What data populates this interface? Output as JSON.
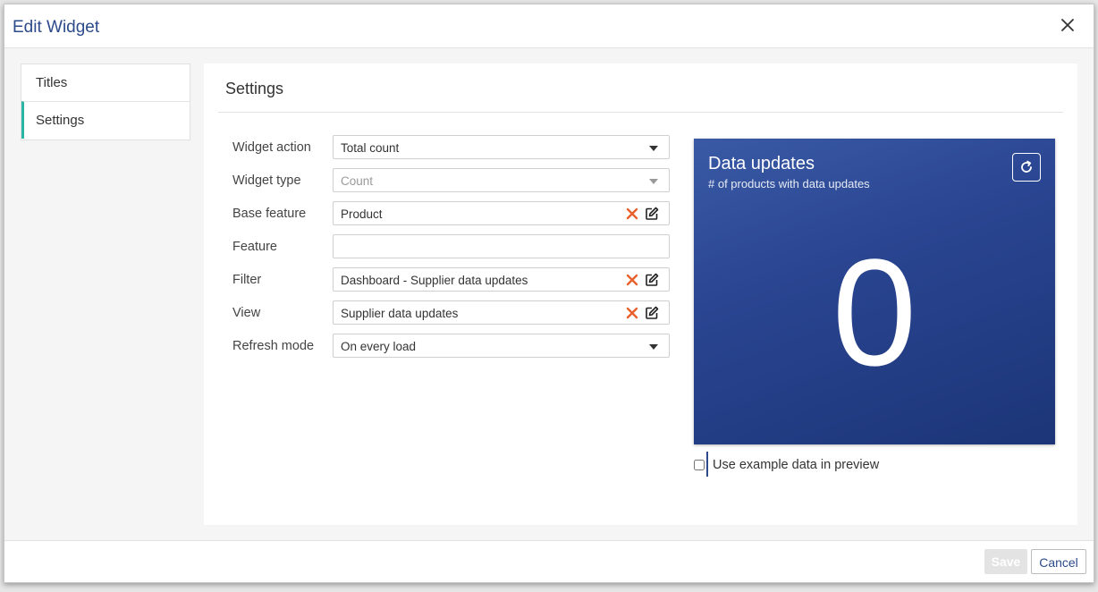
{
  "dialog": {
    "title": "Edit Widget",
    "close_icon": "close-icon"
  },
  "tabs": [
    {
      "label": "Titles",
      "active": false
    },
    {
      "label": "Settings",
      "active": true
    }
  ],
  "panel": {
    "title": "Settings"
  },
  "form": {
    "widget_action": {
      "label": "Widget action",
      "value": "Total count"
    },
    "widget_type": {
      "label": "Widget type",
      "value": "Count",
      "disabled": true
    },
    "base_feature": {
      "label": "Base feature",
      "value": "Product"
    },
    "feature": {
      "label": "Feature",
      "value": ""
    },
    "filter": {
      "label": "Filter",
      "value": "Dashboard - Supplier data updates"
    },
    "view": {
      "label": "View",
      "value": "Supplier data updates"
    },
    "refresh_mode": {
      "label": "Refresh mode",
      "value": "On every load"
    }
  },
  "preview": {
    "title": "Data updates",
    "subtitle": "# of products with data updates",
    "value": "0",
    "refresh_icon": "refresh-icon",
    "background_color": "#2a4591"
  },
  "example_data": {
    "label": "Use example data in preview",
    "checked": false
  },
  "footer": {
    "save_label": "Save",
    "cancel_label": "Cancel"
  },
  "colors": {
    "accent": "#2d4a8a",
    "tab_indicator": "#2bb5a6",
    "clear_icon": "#e8612c"
  }
}
